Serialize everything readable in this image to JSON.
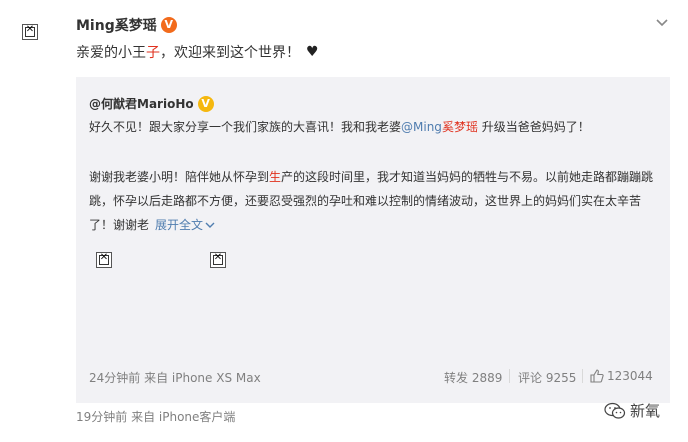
{
  "post": {
    "author": "Ming奚梦瑶",
    "badge": "V",
    "text_part1": "亲爱的小王",
    "text_red": "子",
    "text_part2": "，欢迎来到这个世界！",
    "heart": "♥",
    "meta": "19分钟前  来自 iPhone客户端"
  },
  "repost": {
    "author": "@何猷君MarioHo",
    "badge": "V",
    "p1_a": "好久不见！跟大家分享一个我们家族的大喜讯！我和我老婆",
    "p1_mention_at": "@Ming",
    "p1_mention_name": "奚梦瑶",
    "p1_b": " 升级当爸爸妈妈了！",
    "p2_a": "谢谢我老婆小明！陪伴她从怀孕到",
    "p2_red": "生",
    "p2_b": "产的这段时间里，我才知道当妈妈的牺牲与不易。以前她走路都蹦蹦跳",
    "p2_line2": "跳，怀孕以后走路都不方便，还要忍受强烈的孕吐和难以控制的情绪波动，这世界上的妈妈们实在太辛苦",
    "p2_line3": "了！谢谢老",
    "expand": "展开全文",
    "expand_icon": "chevron-down-icon",
    "meta": "24分钟前  来自 iPhone XS Max",
    "repost_count": "转发 2889",
    "comment_count": "评论 9255",
    "like_count": "123044"
  },
  "watermark": {
    "text": "新氧",
    "icon": "wechat-icon"
  },
  "colors": {
    "red": "#e0321f",
    "link_blue": "#507daf",
    "badge_orange": "#f26b1c",
    "badge_gold": "#f5b80f",
    "repost_bg": "#f2f2f5"
  }
}
